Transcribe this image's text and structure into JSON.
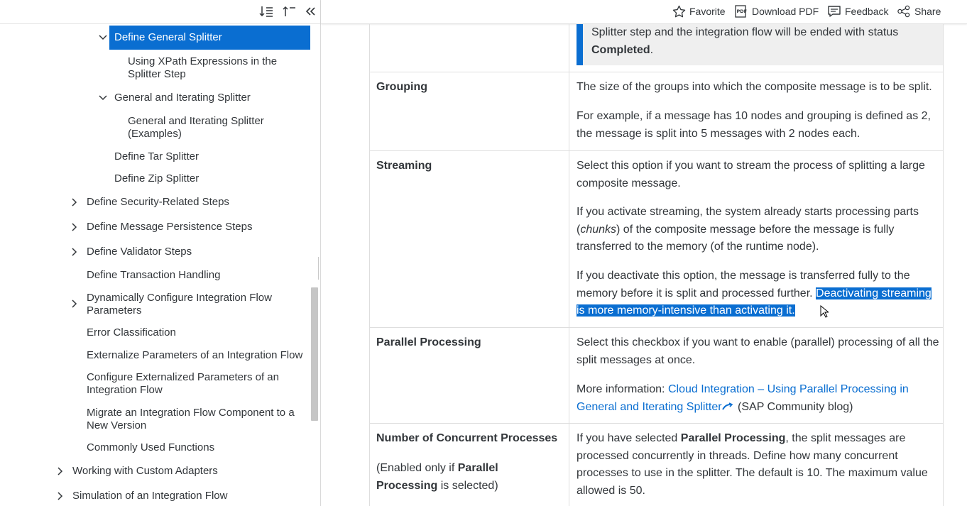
{
  "sidebar": {
    "tree": [
      {
        "label": "Define General Splitter",
        "selected": true
      },
      {
        "label": "Using XPath Expressions in the Splitter Step"
      },
      {
        "label": "General and Iterating Splitter"
      },
      {
        "label": "General and Iterating Splitter (Examples)"
      },
      {
        "label": "Define Tar Splitter"
      },
      {
        "label": "Define Zip Splitter"
      },
      {
        "label": "Define Security-Related Steps"
      },
      {
        "label": "Define Message Persistence Steps"
      },
      {
        "label": "Define Validator Steps"
      },
      {
        "label": "Define Transaction Handling"
      },
      {
        "label": "Dynamically Configure Integration Flow Parameters"
      },
      {
        "label": "Error Classification"
      },
      {
        "label": "Externalize Parameters of an Integration Flow"
      },
      {
        "label": "Configure Externalized Parameters of an Integration Flow"
      },
      {
        "label": "Migrate an Integration Flow Component to a New Version"
      },
      {
        "label": "Commonly Used Functions"
      },
      {
        "label": "Working with Custom Adapters"
      },
      {
        "label": "Simulation of an Integration Flow"
      }
    ]
  },
  "header": {
    "favorite": "Favorite",
    "download_pdf": "Download PDF",
    "feedback": "Feedback",
    "share": "Share"
  },
  "table": {
    "note": {
      "line1": "Splitter step and the integration flow will be ended with status",
      "bold": "Completed",
      "end": "."
    },
    "rows": [
      {
        "param": "Grouping",
        "p1": "The size of the groups into which the composite message is to be split.",
        "p2": "For example, if a message has 10 nodes and grouping is defined as 2, the message is split into 5 messages with 2 nodes each."
      },
      {
        "param": "Streaming",
        "p1": "Select this option if you want to stream the process of splitting a large composite message.",
        "p2a": "If you activate streaming, the system already starts processing parts (",
        "p2i": "chunks",
        "p2b": ") of the composite message before the message is fully transferred to the memory (of the runtime node).",
        "p3a": "If you deactivate this option, the message is transferred fully to the memory before it is split and processed further.",
        "p3hl": "Deactivating streaming is more memory-intensive than activating it."
      },
      {
        "param": "Parallel Processing",
        "p1": "Select this checkbox if you want to enable (parallel) processing of all the split messages at once.",
        "p2a": "More information:",
        "p2link": "Cloud Integration – Using Parallel Processing in General and Iterating Splitter",
        "p2b": "(SAP Community blog)"
      },
      {
        "param": "Number of Concurrent Processes",
        "param_note_a": "(Enabled only if",
        "param_note_bold": "Parallel Processing",
        "param_note_b": "is selected)",
        "p1a": "If you have selected",
        "p1bold": "Parallel Processing",
        "p1b": ", the split messages are processed concurrently in threads. Define how many concurrent processes to use in the splitter. The default is 10. The maximum value allowed is 50."
      }
    ]
  },
  "colors": {
    "accent": "#0a6ed1",
    "text": "#32363a",
    "border": "#dedede",
    "note_bg": "#efefef"
  }
}
